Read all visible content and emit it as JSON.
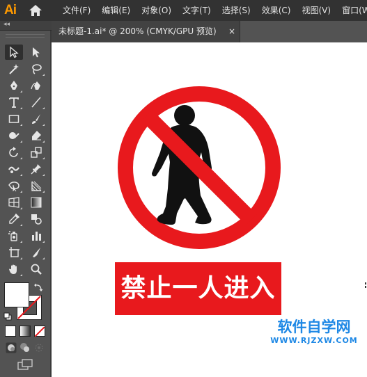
{
  "app": {
    "logo_text": "Ai",
    "accent_color": "#FF9A00"
  },
  "menu": {
    "items": [
      {
        "label": "文件(F)"
      },
      {
        "label": "编辑(E)"
      },
      {
        "label": "对象(O)"
      },
      {
        "label": "文字(T)"
      },
      {
        "label": "选择(S)"
      },
      {
        "label": "效果(C)"
      },
      {
        "label": "视图(V)"
      },
      {
        "label": "窗口(W)"
      }
    ]
  },
  "panel": {
    "collapse_glyph": "◂◂"
  },
  "document": {
    "tab_title": "未标题-1.ai* @ 200% (CMYK/GPU 预览)",
    "close_glyph": "×"
  },
  "tools": [
    {
      "name": "selection-tool",
      "icon": "arrow-icon"
    },
    {
      "name": "direct-selection-tool",
      "icon": "white-arrow-icon"
    },
    {
      "name": "magic-wand-tool",
      "icon": "magic-wand-icon"
    },
    {
      "name": "lasso-tool",
      "icon": "lasso-icon"
    },
    {
      "name": "pen-tool",
      "icon": "pen-icon"
    },
    {
      "name": "curvature-tool",
      "icon": "curvature-icon"
    },
    {
      "name": "type-tool",
      "icon": "type-icon"
    },
    {
      "name": "line-tool",
      "icon": "line-icon"
    },
    {
      "name": "rectangle-tool",
      "icon": "rectangle-icon"
    },
    {
      "name": "paintbrush-tool",
      "icon": "brush-icon"
    },
    {
      "name": "shaper-tool",
      "icon": "shaper-icon"
    },
    {
      "name": "eraser-tool",
      "icon": "eraser-icon"
    },
    {
      "name": "rotate-tool",
      "icon": "rotate-icon"
    },
    {
      "name": "scale-tool",
      "icon": "scale-icon"
    },
    {
      "name": "warp-tool",
      "icon": "warp-icon"
    },
    {
      "name": "puppet-warp-tool",
      "icon": "pin-icon"
    },
    {
      "name": "free-transform-tool",
      "icon": "free-transform-icon"
    },
    {
      "name": "shape-builder-tool",
      "icon": "shape-builder-icon"
    },
    {
      "name": "perspective-grid-tool",
      "icon": "perspective-icon"
    },
    {
      "name": "gradient-tool",
      "icon": "gradient-icon"
    },
    {
      "name": "eyedropper-tool",
      "icon": "eyedropper-icon"
    },
    {
      "name": "blend-tool",
      "icon": "blend-icon"
    },
    {
      "name": "symbol-sprayer-tool",
      "icon": "spray-icon"
    },
    {
      "name": "column-graph-tool",
      "icon": "bar-graph-icon"
    },
    {
      "name": "artboard-tool",
      "icon": "artboard-icon"
    },
    {
      "name": "slice-tool",
      "icon": "knife-icon"
    },
    {
      "name": "hand-tool",
      "icon": "hand-icon"
    },
    {
      "name": "zoom-tool",
      "icon": "zoom-icon"
    }
  ],
  "colors": {
    "sign_red": "#E8191D",
    "figure_black": "#111111",
    "watermark_blue": "#1E88E5"
  },
  "artwork": {
    "banner_text": "禁止一人进入"
  },
  "watermark": {
    "main": "软件自学网",
    "url": "WWW.RJZXW.COM"
  }
}
